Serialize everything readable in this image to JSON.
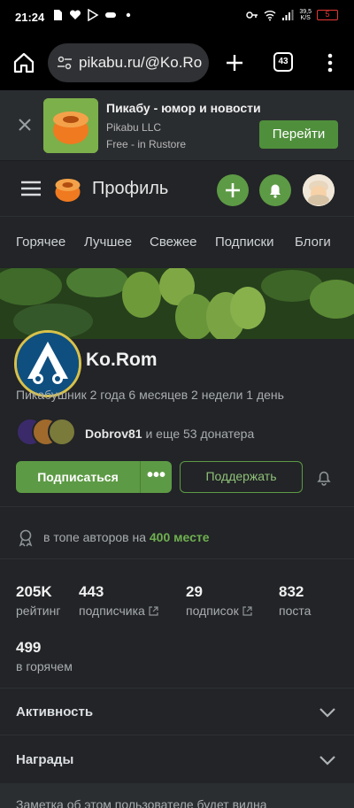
{
  "status_bar": {
    "time": "21:24",
    "speed_top": "39,5",
    "speed_unit": "K/S",
    "battery": "5"
  },
  "browser": {
    "url": "pikabu.ru/@Ko.Rom",
    "tab_count": "43"
  },
  "app_banner": {
    "title": "Пикабу - юмор и новости",
    "publisher": "Pikabu LLC",
    "store": "Free - in Rustore",
    "button": "Перейти"
  },
  "site_header": {
    "title": "Профиль"
  },
  "nav": {
    "items": [
      "Горячее",
      "Лучшее",
      "Свежее",
      "Подписки",
      "Блоги"
    ]
  },
  "profile": {
    "username": "Ko.Rom",
    "account_age": "Пикабушник 2 года 6 месяцев 2 недели 1 день",
    "donator_name": "Dobrov81",
    "donator_rest": " и еще 53 донатера",
    "subscribe_label": "Подписаться",
    "more_label": "•••",
    "support_label": "Поддержать",
    "top_rank_prefix": "в топе авторов на ",
    "top_rank_value": "400 месте"
  },
  "stats": [
    {
      "value": "205K",
      "label": "рейтинг"
    },
    {
      "value": "443",
      "label": "подписчика"
    },
    {
      "value": "29",
      "label": "подписок"
    },
    {
      "value": "832",
      "label": "поста"
    },
    {
      "value": "499",
      "label": "в горячем"
    }
  ],
  "sections": {
    "activity": "Активность",
    "awards": "Награды"
  },
  "note": "Заметка об этом пользователе будет видна",
  "colors": {
    "accent": "#5d9a45",
    "background": "#222427",
    "rank_highlight": "#6fb050"
  }
}
